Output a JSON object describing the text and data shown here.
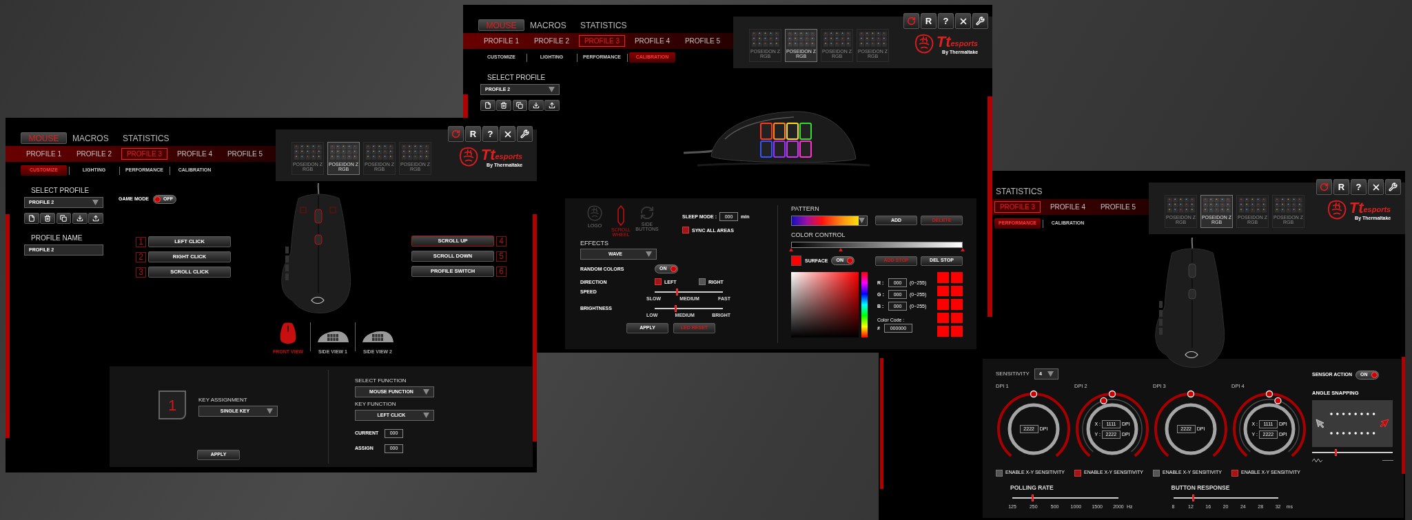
{
  "customize_window": {
    "tabs": [
      {
        "label": "MOUSE",
        "selected": true
      },
      {
        "label": "MACROS",
        "selected": false
      },
      {
        "label": "STATISTICS",
        "selected": false
      }
    ],
    "profiles": [
      {
        "label": "PROFILE 1",
        "selected": false
      },
      {
        "label": "PROFILE 2",
        "selected": false
      },
      {
        "label": "PROFILE 3",
        "selected": true
      },
      {
        "label": "PROFILE 4",
        "selected": false
      },
      {
        "label": "PROFILE 5",
        "selected": false
      }
    ],
    "subtabs": [
      {
        "label": "CUSTOMIZE",
        "selected": true
      },
      {
        "label": "LIGHTING",
        "selected": false
      },
      {
        "label": "PERFORMANCE",
        "selected": false
      },
      {
        "label": "CALIBRATION",
        "selected": false
      }
    ],
    "devices": [
      {
        "label": "POSEIDON Z RGB",
        "selected": false
      },
      {
        "label": "POSEIDON Z RGB",
        "selected": true
      },
      {
        "label": "POSEIDON Z RGB",
        "selected": false
      },
      {
        "label": "POSEIDON Z RGB",
        "selected": false
      }
    ],
    "header_buttons": [
      {
        "kind": "refresh"
      },
      {
        "kind": "letter",
        "label": "R"
      },
      {
        "kind": "letter",
        "label": "?"
      },
      {
        "kind": "close"
      },
      {
        "kind": "tools"
      }
    ],
    "logo": {
      "mark": "Tt",
      "word": "esports",
      "byline": "By Thermaltake"
    },
    "select_profile": {
      "label": "SELECT PROFILE",
      "value": "PROFILE 2"
    },
    "profile_actions": [
      {
        "kind": "new"
      },
      {
        "kind": "delete"
      },
      {
        "kind": "copy"
      },
      {
        "kind": "import"
      },
      {
        "kind": "export"
      }
    ],
    "profile_name": {
      "label": "PROFILE NAME",
      "value": "PROFILE 2"
    },
    "game_mode": {
      "label": "GAME MODE",
      "on": false,
      "text": "OFF"
    },
    "buttons_left": [
      {
        "number": "1",
        "label": "LEFT CLICK",
        "selected": false
      },
      {
        "number": "2",
        "label": "RIGHT CLICK",
        "selected": false
      },
      {
        "number": "3",
        "label": "SCROLL CLICK",
        "selected": false
      }
    ],
    "buttons_right": [
      {
        "number": "4",
        "label": "SCROLL UP",
        "selected": true
      },
      {
        "number": "5",
        "label": "SCROLL DOWN",
        "selected": false
      },
      {
        "number": "6",
        "label": "PROFILE SWITCH",
        "selected": false
      }
    ],
    "views": [
      {
        "kind": "front",
        "label": "FRONT VIEW",
        "selected": true
      },
      {
        "kind": "side",
        "label": "SIDE VIEW 1",
        "selected": false
      },
      {
        "kind": "side",
        "label": "SIDE VIEW 2",
        "selected": false
      }
    ],
    "assignment": {
      "key_number": "1",
      "key_assignment_label": "KEY ASSIGNMENT",
      "key_assignment": "SINGLE KEY",
      "apply": "APPLY",
      "select_function_label": "SELECT FUNCTION",
      "select_function": "MOUSE FUNCTION",
      "key_function_label": "KEY FUNCTION",
      "key_function": "LEFT CLICK",
      "current_label": "CURRENT",
      "current": "000",
      "assign_label": "ASSIGN",
      "assign": "000"
    }
  },
  "lighting_window": {
    "tabs": [
      {
        "label": "MOUSE",
        "selected": true
      },
      {
        "label": "MACROS",
        "selected": false
      },
      {
        "label": "STATISTICS",
        "selected": false
      }
    ],
    "profiles": [
      {
        "label": "PROFILE 1",
        "selected": false
      },
      {
        "label": "PROFILE 2",
        "selected": false
      },
      {
        "label": "PROFILE 3",
        "selected": true
      },
      {
        "label": "PROFILE 4",
        "selected": false
      },
      {
        "label": "PROFILE 5",
        "selected": false
      }
    ],
    "subtabs": [
      {
        "label": "CUSTOMIZE",
        "selected": false
      },
      {
        "label": "LIGHTING",
        "selected": false
      },
      {
        "label": "PERFORMANCE",
        "selected": false
      },
      {
        "label": "CALIBRATION",
        "selected": true
      }
    ],
    "devices": [
      {
        "label": "POSEIDON Z RGB",
        "selected": false
      },
      {
        "label": "POSEIDON Z RGB",
        "selected": true
      },
      {
        "label": "POSEIDON Z RGB",
        "selected": false
      },
      {
        "label": "POSEIDON Z RGB",
        "selected": false
      }
    ],
    "header_buttons": [
      {
        "kind": "refresh"
      },
      {
        "kind": "letter",
        "label": "R"
      },
      {
        "kind": "letter",
        "label": "?"
      },
      {
        "kind": "close"
      },
      {
        "kind": "tools"
      }
    ],
    "logo": {
      "mark": "Tt",
      "word": "esports",
      "byline": "By Thermaltake"
    },
    "select_profile": {
      "label": "SELECT PROFILE",
      "value": "PROFILE 2"
    },
    "profile_actions": [
      {
        "kind": "new"
      },
      {
        "kind": "delete"
      },
      {
        "kind": "copy"
      },
      {
        "kind": "import"
      },
      {
        "kind": "export"
      }
    ],
    "areas": [
      {
        "kind": "logo",
        "label": "LOGO",
        "selected": false
      },
      {
        "kind": "wheel",
        "label": "SCROLL WHEEL",
        "selected": true
      },
      {
        "kind": "side",
        "label": "SIDE BUTTONS",
        "selected": false
      }
    ],
    "sleep": {
      "label": "SLEEP MODE :",
      "value": "000",
      "unit": "min"
    },
    "sync": {
      "label": "SYNC ALL AREAS",
      "checked": true
    },
    "effects": {
      "label": "EFFECTS",
      "value": "WAVE"
    },
    "random_colors": {
      "label": "RANDOM COLORS",
      "on": true,
      "text": "ON"
    },
    "direction": {
      "label": "DIRECTION",
      "options": [
        {
          "label": "LEFT",
          "checked": true
        },
        {
          "label": "RIGHT",
          "checked": false
        }
      ]
    },
    "speed": {
      "label": "SPEED",
      "level": 0.32,
      "marks": [
        "SLOW",
        "MEDIUM",
        "FAST"
      ]
    },
    "brightness": {
      "label": "BRIGHTNESS",
      "level": 0.3,
      "marks": [
        "LOW",
        "MEDIUM",
        "BRIGHT"
      ]
    },
    "apply": "APPLY",
    "reset": "LED RESET",
    "pattern": {
      "label": "PATTERN",
      "add": "ADD",
      "delete": "DELETE"
    },
    "color_control": {
      "label": "COLOR CONTROL",
      "stops": [
        {
          "level": 0
        },
        {
          "level": 0.29
        },
        {
          "level": 1
        }
      ],
      "add_stop": "ADD STOP",
      "del_stop": "DEL STOP"
    },
    "surface": {
      "label": "SURFACE",
      "color": "#ff0000",
      "on": true,
      "text": "ON"
    },
    "channels": [
      {
        "label": "R :",
        "value": "000",
        "range": "(0~255)"
      },
      {
        "label": "G :",
        "value": "000",
        "range": "(0~255)"
      },
      {
        "label": "B :",
        "value": "000",
        "range": "(0~255)"
      }
    ],
    "color_code": {
      "label": "Color Code :",
      "hash": "#",
      "value": "000000"
    },
    "swatches": [
      {
        "color": "#ff0000"
      },
      {
        "color": "#ff0000"
      },
      {
        "color": "#ff0000"
      },
      {
        "color": "#ff0000"
      },
      {
        "color": "#ff0000"
      },
      {
        "color": "#ff0000"
      },
      {
        "color": "#ff0000"
      },
      {
        "color": "#ff0000"
      },
      {
        "color": "#ff0000"
      },
      {
        "color": "#ff0000"
      }
    ]
  },
  "performance_window": {
    "tabs": [
      {
        "label": "STATISTICS",
        "selected": false
      }
    ],
    "profiles": [
      {
        "label": "PROFILE 3",
        "selected": true
      },
      {
        "label": "PROFILE 4",
        "selected": false
      },
      {
        "label": "PROFILE 5",
        "selected": false
      }
    ],
    "subtabs": [
      {
        "label": "PERFORMANCE",
        "selected": true
      },
      {
        "label": "CALIBRATION",
        "selected": false
      }
    ],
    "devices": [
      {
        "label": "POSEIDON Z RGB",
        "selected": false
      },
      {
        "label": "POSEIDON Z RGB",
        "selected": true
      },
      {
        "label": "POSEIDON Z RGB",
        "selected": false
      },
      {
        "label": "POSEIDON Z RGB",
        "selected": false
      }
    ],
    "header_buttons": [
      {
        "kind": "refresh"
      },
      {
        "kind": "letter",
        "label": "R"
      },
      {
        "kind": "letter",
        "label": "?"
      },
      {
        "kind": "close"
      },
      {
        "kind": "tools"
      }
    ],
    "logo": {
      "mark": "Tt",
      "word": "esports",
      "byline": "By Thermaltake"
    },
    "sensitivity": {
      "label": "SENSITIVITY",
      "value": "4"
    },
    "sensor_action": {
      "label": "SENSOR ACTION",
      "on": true,
      "text": "ON"
    },
    "dpis": [
      {
        "label": "DPI 1",
        "kind": "single",
        "knobs": [
          {
            "level": 0.5
          }
        ],
        "fields": [
          {
            "value": "2222",
            "unit": "DPI"
          }
        ],
        "xy": {
          "label": "ENABLE X-Y SENSITIVITY",
          "checked": false
        }
      },
      {
        "label": "DPI 2",
        "kind": "xy",
        "knobs": [
          {
            "level": 0.5
          },
          {
            "level": 0.44
          }
        ],
        "fields": [
          {
            "label": "X :",
            "value": "1111",
            "unit": "DPI"
          },
          {
            "label": "Y :",
            "value": "2222",
            "unit": "DPI"
          }
        ],
        "xy": {
          "label": "ENABLE X-Y SENSITIVITY",
          "checked": true
        }
      },
      {
        "label": "DPI 3",
        "kind": "single",
        "knobs": [
          {
            "level": 0.5
          }
        ],
        "fields": [
          {
            "value": "2222",
            "unit": "DPI"
          }
        ],
        "xy": {
          "label": "ENABLE X-Y SENSITIVITY",
          "checked": false
        }
      },
      {
        "label": "DPI 4",
        "kind": "xy",
        "knobs": [
          {
            "level": 0.5
          },
          {
            "level": 0.56
          }
        ],
        "fields": [
          {
            "label": "X :",
            "value": "1111",
            "unit": "DPI"
          },
          {
            "label": "Y :",
            "value": "2222",
            "unit": "DPI"
          }
        ],
        "xy": {
          "label": "ENABLE X-Y SENSITIVITY",
          "checked": true
        }
      }
    ],
    "angle_snapping": {
      "label": "ANGLE SNAPPING",
      "level": 0.29
    },
    "polling": {
      "label": "POLLING RATE",
      "level": 0.19,
      "ticks": [
        "125",
        "250",
        "500",
        "1000",
        "1500",
        "2000"
      ],
      "unit": "Hz"
    },
    "response": {
      "label": "BUTTON RESPONSE",
      "level": 0.19,
      "ticks": [
        "8",
        "12",
        "16",
        "20",
        "24",
        "28",
        "32"
      ],
      "unit": "ms"
    }
  }
}
